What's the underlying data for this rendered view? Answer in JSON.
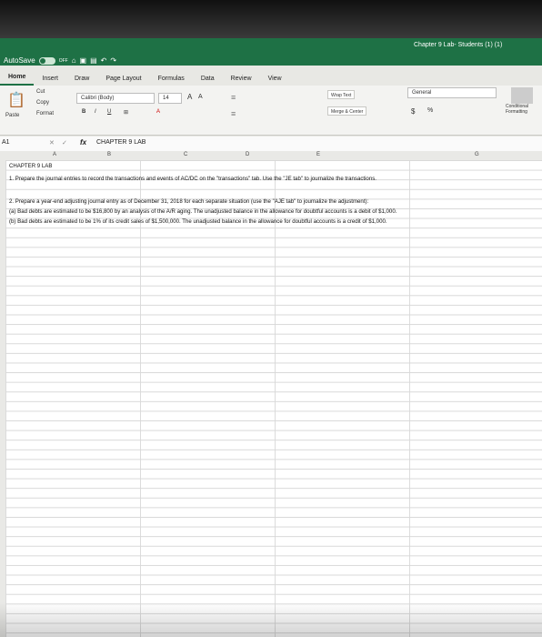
{
  "title_bar": {
    "autosave_label": "AutoSave",
    "autosave_state": "OFF",
    "document_title": "Chapter 9 Lab- Students (1) (1)"
  },
  "ribbon_tabs": [
    "Home",
    "Insert",
    "Draw",
    "Page Layout",
    "Formulas",
    "Data",
    "Review",
    "View"
  ],
  "ribbon": {
    "paste": "Paste",
    "cut": "Cut",
    "copy": "Copy",
    "format": "Format",
    "font_name": "Calibri (Body)",
    "font_size": "14",
    "wrap_text": "Wrap Text",
    "merge_center": "Merge & Center",
    "number_format": "General",
    "conditional_formatting": "Conditional Formatting"
  },
  "formula_bar": {
    "name_box": "A1",
    "fx": "fx",
    "value": "CHAPTER 9 LAB"
  },
  "columns": [
    "A",
    "B",
    "C",
    "D",
    "E",
    "G"
  ],
  "sheet": {
    "line1": "CHAPTER 9 LAB",
    "line2": "1. Prepare the journal entries to record the transactions and events of AC/DC on the \"transactions\" tab. Use the \"JE tab\" to journalize the transactions.",
    "line3": "2. Prepare a year-end adjusting journal entry as of December 31, 2018 for each separate situation (use the \"AJE tab\" to journalize the adjustment):",
    "line4": "(a) Bad debts are estimated to be $16,800 by an analysis of the A/R aging. The unadjusted balance in the allowance for doubtful accounts is a debit of $1,000.",
    "line5": "(b) Bad debts are estimated to be 1% of its credit sales of $1,500,000. The unadjusted balance in the allowance for doubtful accounts is a credit of $1,000."
  },
  "colors": {
    "excel_green": "#1e7145"
  }
}
